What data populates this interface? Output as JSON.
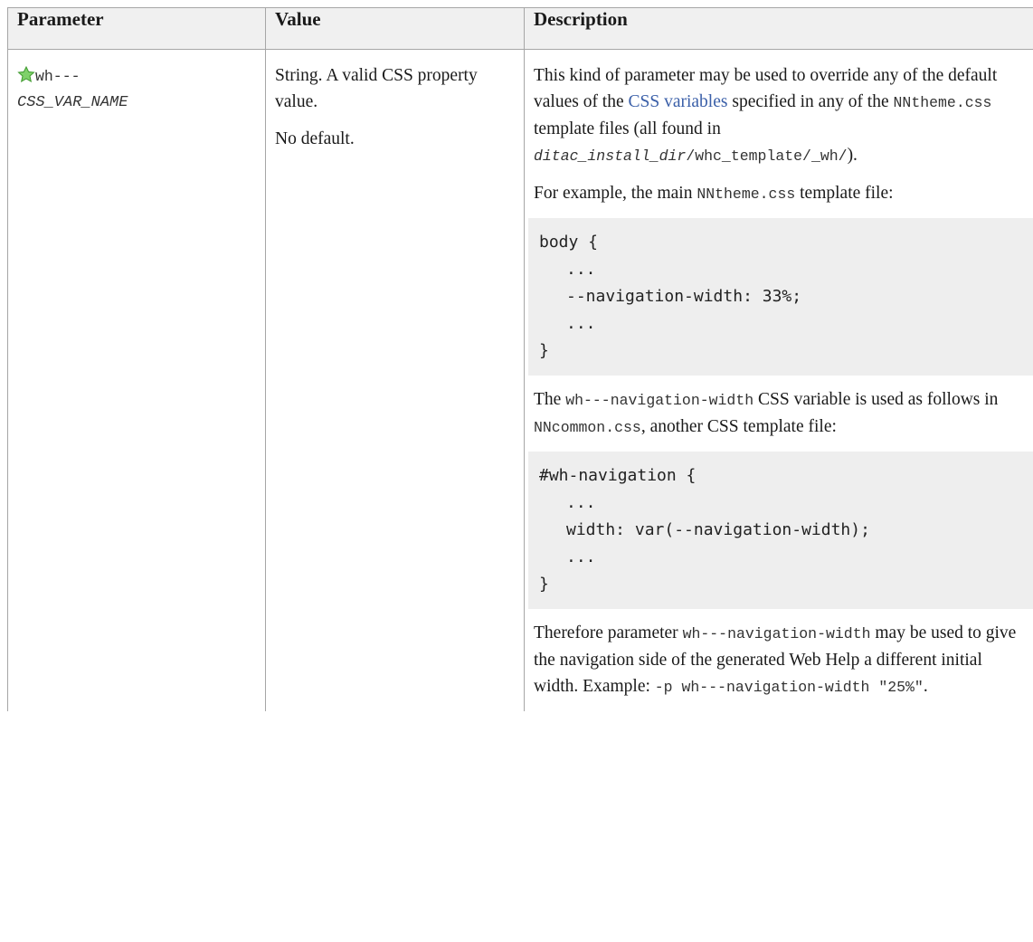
{
  "headers": {
    "parameter": "Parameter",
    "value": "Value",
    "description": "Description"
  },
  "row": {
    "param_prefix": "wh---",
    "param_var": "CSS_VAR_NAME",
    "value_line1": "String. A valid CSS property value.",
    "value_line2": "No default.",
    "desc_p1_a": "This kind of parameter may be used to override any of the default values of the ",
    "desc_p1_link": "CSS variables",
    "desc_p1_b": " specified in any of the ",
    "desc_p1_code1": "NNtheme.css",
    "desc_p1_c": " template files (all found in ",
    "desc_p1_code2_it": "ditac_install_dir",
    "desc_p1_code2_rest": "/whc_template/_wh/",
    "desc_p1_d": ").",
    "desc_p2_a": "For example, the main ",
    "desc_p2_code": "NNtheme.css",
    "desc_p2_b": " template file:",
    "code1": [
      "body {",
      "...",
      "--navigation-width: 33%;",
      "...",
      "}"
    ],
    "desc_p3_code1": "wh---navigation-width",
    "desc_p3_a": "The ",
    "desc_p3_b": " CSS variable is used as follows in ",
    "desc_p3_code2": "NNcommon.css",
    "desc_p3_c": ", another CSS template file:",
    "code2": [
      "#wh-navigation {",
      "...",
      "width: var(--navigation-width);",
      "...",
      "}"
    ],
    "desc_p4_a": "Therefore parameter ",
    "desc_p4_code1": "wh---navigation-width",
    "desc_p4_b": " may be used to give the navigation side of the generated Web Help a different initial width. Example: ",
    "desc_p4_code2": "-p wh---navigation-width \"25%\"",
    "desc_p4_c": "."
  },
  "colors": {
    "link": "#3a5fa8",
    "header_bg": "#f0f0f0",
    "code_bg": "#eeeeee",
    "border": "#a6a6a6",
    "star": "#5cc04a"
  }
}
